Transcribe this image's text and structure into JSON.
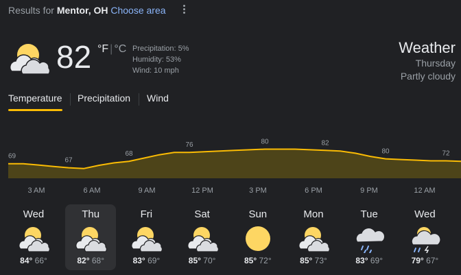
{
  "header": {
    "results_prefix": "Results for",
    "location": "Mentor, OH",
    "choose_area": "Choose area"
  },
  "current": {
    "icon": "partly-cloudy-icon",
    "temp": "82",
    "unit_f": "°F",
    "unit_c": "°C",
    "precipitation": "Precipitation: 5%",
    "humidity": "Humidity: 53%",
    "wind": "Wind: 10 mph"
  },
  "summary": {
    "title": "Weather",
    "day": "Thursday",
    "condition": "Partly cloudy"
  },
  "tabs": [
    "Temperature",
    "Precipitation",
    "Wind"
  ],
  "active_tab": "Temperature",
  "colors": {
    "background": "#202124",
    "accent": "#fbbc04",
    "sun": "#fdd663",
    "chart_fill": "#4d4419",
    "chart_line": "#fbbc04"
  },
  "chart_data": {
    "type": "area",
    "x": [
      "3 AM",
      "6 AM",
      "9 AM",
      "12 PM",
      "3 PM",
      "6 PM",
      "9 PM",
      "12 AM"
    ],
    "labeled_values": [
      69,
      67,
      68,
      76,
      80,
      82,
      80,
      72
    ],
    "values": [
      69,
      69,
      68.2,
      67.3,
      66.5,
      66,
      68,
      69.5,
      70.5,
      72.5,
      74.5,
      76,
      76,
      76.4,
      76.8,
      77.2,
      77.6,
      78,
      78,
      78,
      77.6,
      77.2,
      76.8,
      75.5,
      73.5,
      72,
      71.6,
      71.2,
      70.8,
      70.8,
      70.5
    ]
  },
  "hours": [
    "3 AM",
    "6 AM",
    "9 AM",
    "12 PM",
    "3 PM",
    "6 PM",
    "9 PM",
    "12 AM"
  ],
  "days": [
    {
      "name": "Wed",
      "icon": "partly-cloudy-icon",
      "high": "84°",
      "low": "66°"
    },
    {
      "name": "Thu",
      "icon": "partly-cloudy-icon",
      "high": "82°",
      "low": "68°"
    },
    {
      "name": "Fri",
      "icon": "partly-cloudy-icon",
      "high": "83°",
      "low": "69°"
    },
    {
      "name": "Sat",
      "icon": "partly-cloudy-icon",
      "high": "85°",
      "low": "70°"
    },
    {
      "name": "Sun",
      "icon": "sunny-icon",
      "high": "85°",
      "low": "72°"
    },
    {
      "name": "Mon",
      "icon": "partly-cloudy-icon",
      "high": "85°",
      "low": "73°"
    },
    {
      "name": "Tue",
      "icon": "rain-icon",
      "high": "83°",
      "low": "69°"
    },
    {
      "name": "Wed",
      "icon": "thunderstorm-icon",
      "high": "79°",
      "low": "67°"
    }
  ],
  "selected_day": 1
}
